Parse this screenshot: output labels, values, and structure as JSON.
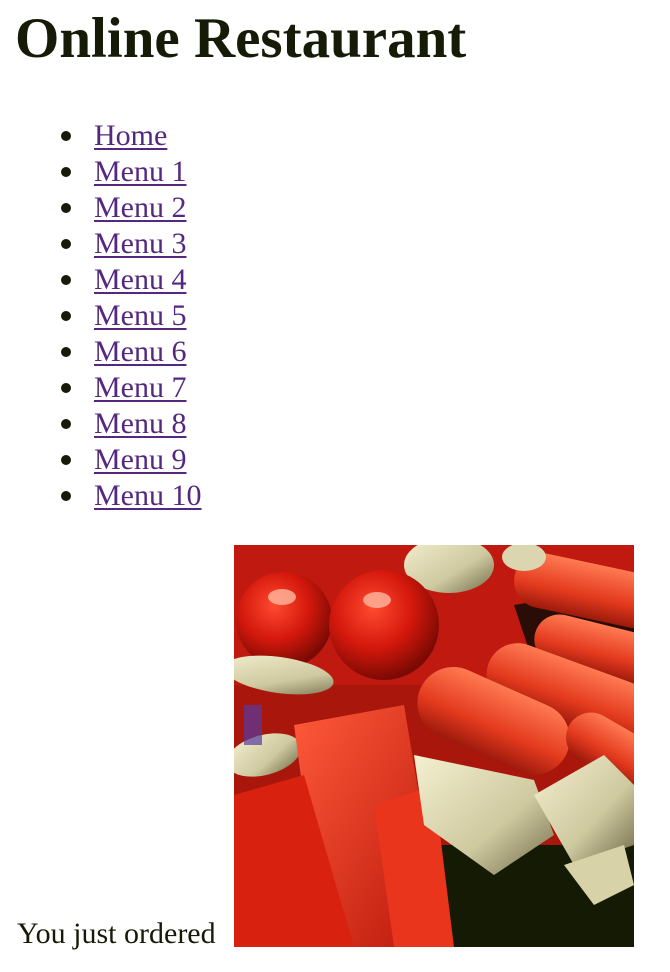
{
  "header": {
    "title": "Online Restaurant"
  },
  "nav": {
    "items": [
      {
        "label": "Home"
      },
      {
        "label": "Menu 1"
      },
      {
        "label": "Menu 2"
      },
      {
        "label": "Menu 3"
      },
      {
        "label": "Menu 4"
      },
      {
        "label": "Menu 5"
      },
      {
        "label": "Menu 6"
      },
      {
        "label": "Menu 7"
      },
      {
        "label": "Menu 8"
      },
      {
        "label": "Menu 9"
      },
      {
        "label": "Menu 10"
      }
    ]
  },
  "main": {
    "order_text": "You just ordered",
    "image_icon": "vegetables-photo"
  },
  "colors": {
    "text": "#151b06",
    "link": "#54287f",
    "background": "#ffffff"
  }
}
